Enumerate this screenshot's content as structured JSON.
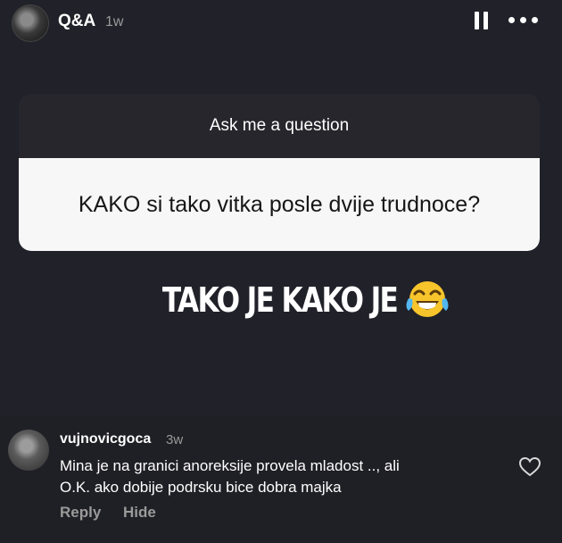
{
  "header": {
    "title": "Q&A",
    "time": "1w"
  },
  "question_card": {
    "prompt": "Ask me a question",
    "question": "KAKO si tako vitka posle dvije trudnoce?"
  },
  "answer": {
    "text": "TAKO JE KAKO JE",
    "emoji_icon": "face-with-tears-of-joy-icon"
  },
  "comment": {
    "username": "vujnovicgoca",
    "time": "3w",
    "text_lines": [
      "Mina je na granici anoreksije provela mladost .., ali",
      "O.K. ako dobije podrsku bice dobra majka"
    ],
    "reply_label": "Reply",
    "hide_label": "Hide"
  }
}
